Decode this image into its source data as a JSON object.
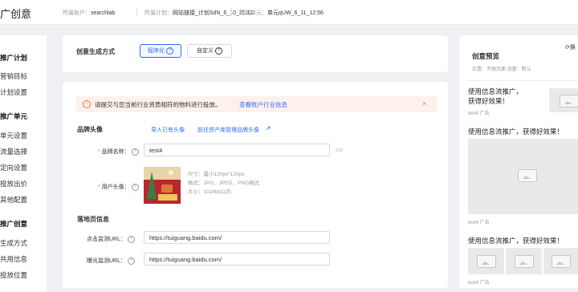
{
  "header": {
    "title": "广创意",
    "account_label": "所属账户：",
    "account_value": "searchlab",
    "plan_label": "所属计划：",
    "plan_value": "网站链接_计划SdN_6_10_21:11",
    "unit_label": "所属单元：",
    "unit_value": "单元qUW_6_11_12:56"
  },
  "sidebar": {
    "items": [
      {
        "label": "推广计划",
        "group": true
      },
      {
        "label": "营销目标"
      },
      {
        "label": "计划设置"
      },
      {
        "label": "推广单元",
        "group": true
      },
      {
        "label": "单元设置"
      },
      {
        "label": "流量选择"
      },
      {
        "label": "定向设置"
      },
      {
        "label": "投放出价"
      },
      {
        "label": "其他配置"
      },
      {
        "label": "推广创意",
        "group": true
      },
      {
        "label": "生成方式"
      },
      {
        "label": "共用信息"
      },
      {
        "label": "投放位置"
      }
    ]
  },
  "creative_mode": {
    "label": "创意生成方式",
    "options": [
      {
        "label": "程序化",
        "selected": true
      },
      {
        "label": "自定义",
        "selected": false
      }
    ]
  },
  "notice": {
    "text": "请提交与您当前行业资质相符的物料进行投放。",
    "link": "查看账户行业信息",
    "close": "×"
  },
  "brand": {
    "section_title": "品牌头像",
    "import_link": "导入已有头像",
    "manage_link": "前往资产库管理品牌头像",
    "name_label": "品牌名称",
    "name_value": "test4",
    "name_count": "5/8",
    "avatar_label": "用户头像",
    "spec_size": "尺寸：最小120px*120px",
    "spec_format": "格式：JPG、JPEG、PNG格式",
    "spec_filesize": "大小：1024kb以内"
  },
  "landing": {
    "section_title": "落地页信息",
    "click_label": "点击监测URL",
    "click_value": "https://tuiguang.baidu.com/",
    "impression_label": "曝光监测URL",
    "impression_value": "https://tuiguang.baidu.com/"
  },
  "preview": {
    "title": "创意预览",
    "subtitle": "位置：不限页面  流量：默认",
    "top_action": "换",
    "ads": [
      {
        "title": "使用信息流推广，获得好效果！",
        "tag": "test4 广告"
      },
      {
        "title": "使用信息流推广，获得好效果！",
        "tag": "test4 广告"
      },
      {
        "title": "使用信息流推广，获得好效果！",
        "tag": "test4 广告"
      }
    ]
  },
  "colors": {
    "accent": "#2f6bff",
    "notice_bg": "#fdf1ec",
    "warn_icon": "#e8763a"
  }
}
